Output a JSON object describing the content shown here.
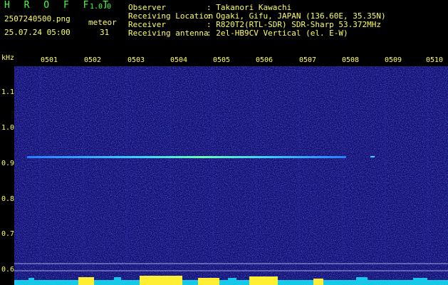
{
  "header": {
    "app_name": "H R O F F T",
    "version": "1.0.0",
    "filename": "2507240500.png",
    "datetime": "25.07.24 05:00",
    "meteor_label": "meteor",
    "meteor_count": "31",
    "info_keys": [
      "Observer",
      "Receiving Location",
      "Receiver",
      "Receiving antenna"
    ],
    "info_values": [
      ": Takanori Kawachi",
      ": Ogaki, Gifu, JAPAN (136.60E, 35.35N)",
      ": R820T2(RTL-SDR) SDR-Sharp 53.372MHz",
      ": 2el-HB9CV Vertical (el. E-W)"
    ]
  },
  "axis": {
    "unit": "kHz",
    "time_ticks": [
      "0501",
      "0502",
      "0503",
      "0504",
      "0505",
      "0506",
      "0507",
      "0508",
      "0509",
      "0510"
    ],
    "freq_ticks": [
      "1.1",
      "1.0",
      "0.9",
      "0.8",
      "0.7",
      "0.6"
    ]
  },
  "colors": {
    "background": "#000000",
    "waterfall_base": "#1c1c8c",
    "signal": "#38d8ff",
    "label": "#ffff66",
    "header_green": "#44ff44"
  }
}
